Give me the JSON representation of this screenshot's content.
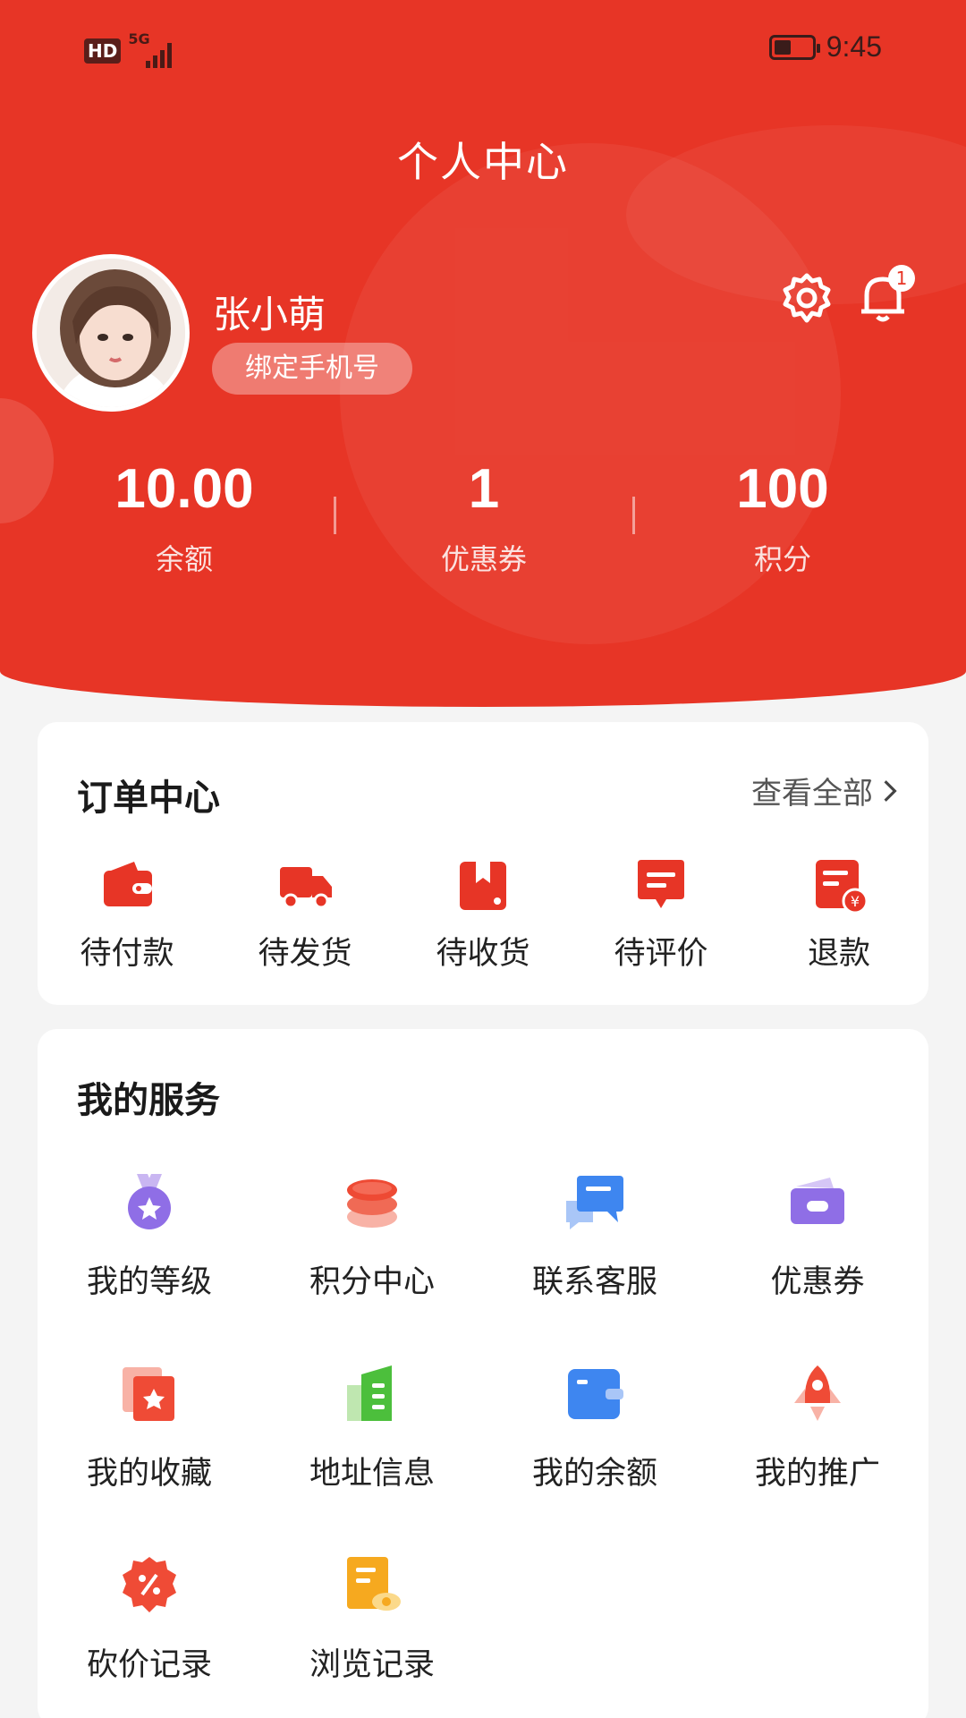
{
  "status_bar": {
    "hd": "HD",
    "network": "5G",
    "time": "9:45"
  },
  "header": {
    "title": "个人中心",
    "username": "张小萌",
    "bind_phone": "绑定手机号",
    "notification_count": "1"
  },
  "stats": [
    {
      "value": "10.00",
      "label": "余额"
    },
    {
      "value": "1",
      "label": "优惠券"
    },
    {
      "value": "100",
      "label": "积分"
    }
  ],
  "orders": {
    "title": "订单中心",
    "view_all": "查看全部",
    "items": [
      {
        "label": "待付款",
        "icon": "wallet-icon"
      },
      {
        "label": "待发货",
        "icon": "truck-icon"
      },
      {
        "label": "待收货",
        "icon": "package-icon"
      },
      {
        "label": "待评价",
        "icon": "comment-icon"
      },
      {
        "label": "退款",
        "icon": "refund-icon"
      }
    ]
  },
  "services": {
    "title": "我的服务",
    "items": [
      {
        "label": "我的等级",
        "icon": "medal-icon"
      },
      {
        "label": "积分中心",
        "icon": "coins-icon"
      },
      {
        "label": "联系客服",
        "icon": "chat-icon"
      },
      {
        "label": "优惠券",
        "icon": "coupon-icon"
      },
      {
        "label": "我的收藏",
        "icon": "favorite-icon"
      },
      {
        "label": "地址信息",
        "icon": "address-icon"
      },
      {
        "label": "我的余额",
        "icon": "balance-wallet-icon"
      },
      {
        "label": "我的推广",
        "icon": "rocket-icon"
      },
      {
        "label": "砍价记录",
        "icon": "discount-icon"
      },
      {
        "label": "浏览记录",
        "icon": "history-icon"
      }
    ]
  },
  "colors": {
    "brand": "#e73526",
    "background": "#f4f4f4"
  }
}
